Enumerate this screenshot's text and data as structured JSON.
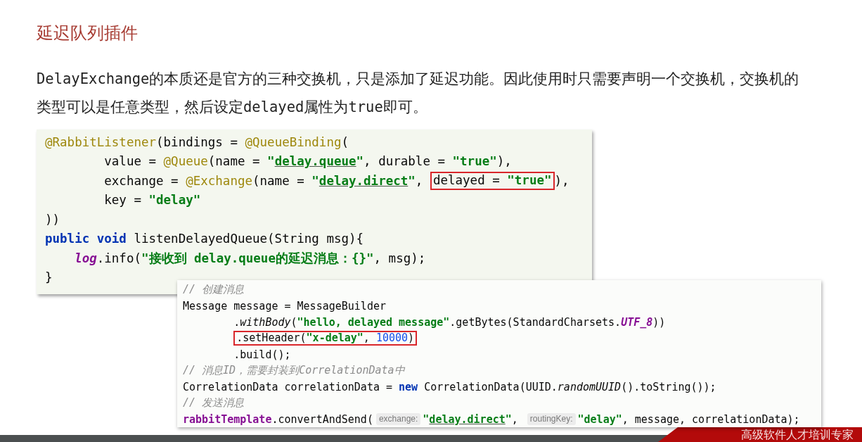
{
  "title": "延迟队列插件",
  "description": "DelayExchange的本质还是官方的三种交换机，只是添加了延迟功能。因此使用时只需要声明一个交换机，交换机的类型可以是任意类型，然后设定delayed属性为true即可。",
  "code_blocks": [
    {
      "lines": [
        {
          "segments": [
            {
              "kind": "annotation",
              "text": "@RabbitListener"
            },
            {
              "kind": "plain",
              "text": "(bindings = "
            },
            {
              "kind": "annotation",
              "text": "@QueueBinding"
            },
            {
              "kind": "plain",
              "text": "("
            }
          ],
          "continued": [
            {
              "segments": [
                {
                  "kind": "plain",
                  "text": "value = "
                },
                {
                  "kind": "annotation",
                  "text": "@Queue"
                },
                {
                  "kind": "plain",
                  "text": "(name = "
                },
                {
                  "kind": "string",
                  "text": "\""
                },
                {
                  "kind": "link",
                  "text": "delay.queue"
                },
                {
                  "kind": "string",
                  "text": "\""
                },
                {
                  "kind": "plain",
                  "text": ", durable = "
                },
                {
                  "kind": "string",
                  "text": "\"true\""
                },
                {
                  "kind": "plain",
                  "text": "),"
                }
              ]
            },
            {
              "segments": [
                {
                  "kind": "plain",
                  "text": "exchange = "
                },
                {
                  "kind": "annotation",
                  "text": "@Exchange"
                },
                {
                  "kind": "plain",
                  "text": "(name = "
                },
                {
                  "kind": "string",
                  "text": "\""
                },
                {
                  "kind": "link",
                  "text": "delay.direct"
                },
                {
                  "kind": "string",
                  "text": "\""
                },
                {
                  "kind": "plain",
                  "text": ", "
                },
                {
                  "kind": "highlight-box",
                  "tokens": [
                    {
                      "kind": "plain",
                      "text": "delayed = "
                    },
                    {
                      "kind": "string",
                      "text": "\"true\""
                    }
                  ]
                },
                {
                  "kind": "plain",
                  "text": "),"
                }
              ]
            },
            {
              "segments": [
                {
                  "kind": "plain",
                  "text": "key = "
                },
                {
                  "kind": "string",
                  "text": "\"delay\""
                }
              ]
            }
          ]
        },
        {
          "segments": [
            {
              "kind": "plain",
              "text": "))"
            }
          ]
        },
        {
          "segments": [
            {
              "kind": "keyword",
              "text": "public void"
            },
            {
              "kind": "plain",
              "text": " listenDelayedQueue(String msg){"
            }
          ],
          "children": [
            {
              "segments": [
                {
                  "kind": "static-field",
                  "text": "log"
                },
                {
                  "kind": "plain",
                  "text": ".info("
                },
                {
                  "kind": "string",
                  "text": "\"接收到 delay.queue的延迟消息：{}\""
                },
                {
                  "kind": "plain",
                  "text": ", msg);"
                }
              ]
            }
          ]
        },
        {
          "segments": [
            {
              "kind": "plain",
              "text": "}"
            }
          ]
        }
      ]
    },
    {
      "lines": [
        {
          "segments": [
            {
              "kind": "comment",
              "text": "// 创建消息"
            }
          ]
        },
        {
          "segments": [
            {
              "kind": "plain",
              "text": "Message message = MessageBuilder"
            }
          ],
          "continued": [
            {
              "segments": [
                {
                  "kind": "plain",
                  "text": "."
                },
                {
                  "kind": "method",
                  "text": "withBody"
                },
                {
                  "kind": "plain",
                  "text": "("
                },
                {
                  "kind": "string",
                  "text": "\"hello, delayed message\""
                },
                {
                  "kind": "plain",
                  "text": ".getBytes(StandardCharsets."
                },
                {
                  "kind": "constant",
                  "text": "UTF_8"
                },
                {
                  "kind": "plain",
                  "text": "))"
                }
              ]
            },
            {
              "segments": [
                {
                  "kind": "highlight-box",
                  "tokens": [
                    {
                      "kind": "plain",
                      "text": ".setHeader("
                    },
                    {
                      "kind": "string",
                      "text": "\"x-delay\""
                    },
                    {
                      "kind": "plain",
                      "text": ", "
                    },
                    {
                      "kind": "number",
                      "text": "10000"
                    },
                    {
                      "kind": "plain",
                      "text": ")"
                    }
                  ]
                }
              ]
            },
            {
              "segments": [
                {
                  "kind": "plain",
                  "text": ".build();"
                }
              ]
            }
          ]
        },
        {
          "segments": [
            {
              "kind": "comment",
              "text": "// 消息ID，需要封装到CorrelationData中"
            }
          ]
        },
        {
          "segments": [
            {
              "kind": "plain",
              "text": "CorrelationData correlationData = "
            },
            {
              "kind": "keyword",
              "text": "new"
            },
            {
              "kind": "plain",
              "text": " CorrelationData(UUID."
            },
            {
              "kind": "method",
              "text": "randomUUID"
            },
            {
              "kind": "plain",
              "text": "().toString());"
            }
          ]
        },
        {
          "segments": [
            {
              "kind": "comment",
              "text": "// 发送消息"
            }
          ]
        },
        {
          "segments": [
            {
              "kind": "field",
              "text": "rabbitTemplate"
            },
            {
              "kind": "plain",
              "text": ".convertAndSend("
            },
            {
              "kind": "hint",
              "text": "exchange:"
            },
            {
              "kind": "string",
              "text": "\""
            },
            {
              "kind": "link",
              "text": "delay.direct"
            },
            {
              "kind": "string",
              "text": "\""
            },
            {
              "kind": "plain",
              "text": ", "
            },
            {
              "kind": "hint",
              "text": "routingKey:"
            },
            {
              "kind": "string",
              "text": "\"delay\""
            },
            {
              "kind": "plain",
              "text": ", message, correlationData);"
            }
          ]
        }
      ]
    }
  ],
  "footer": {
    "slogan": "高级软件人才培训专家"
  }
}
